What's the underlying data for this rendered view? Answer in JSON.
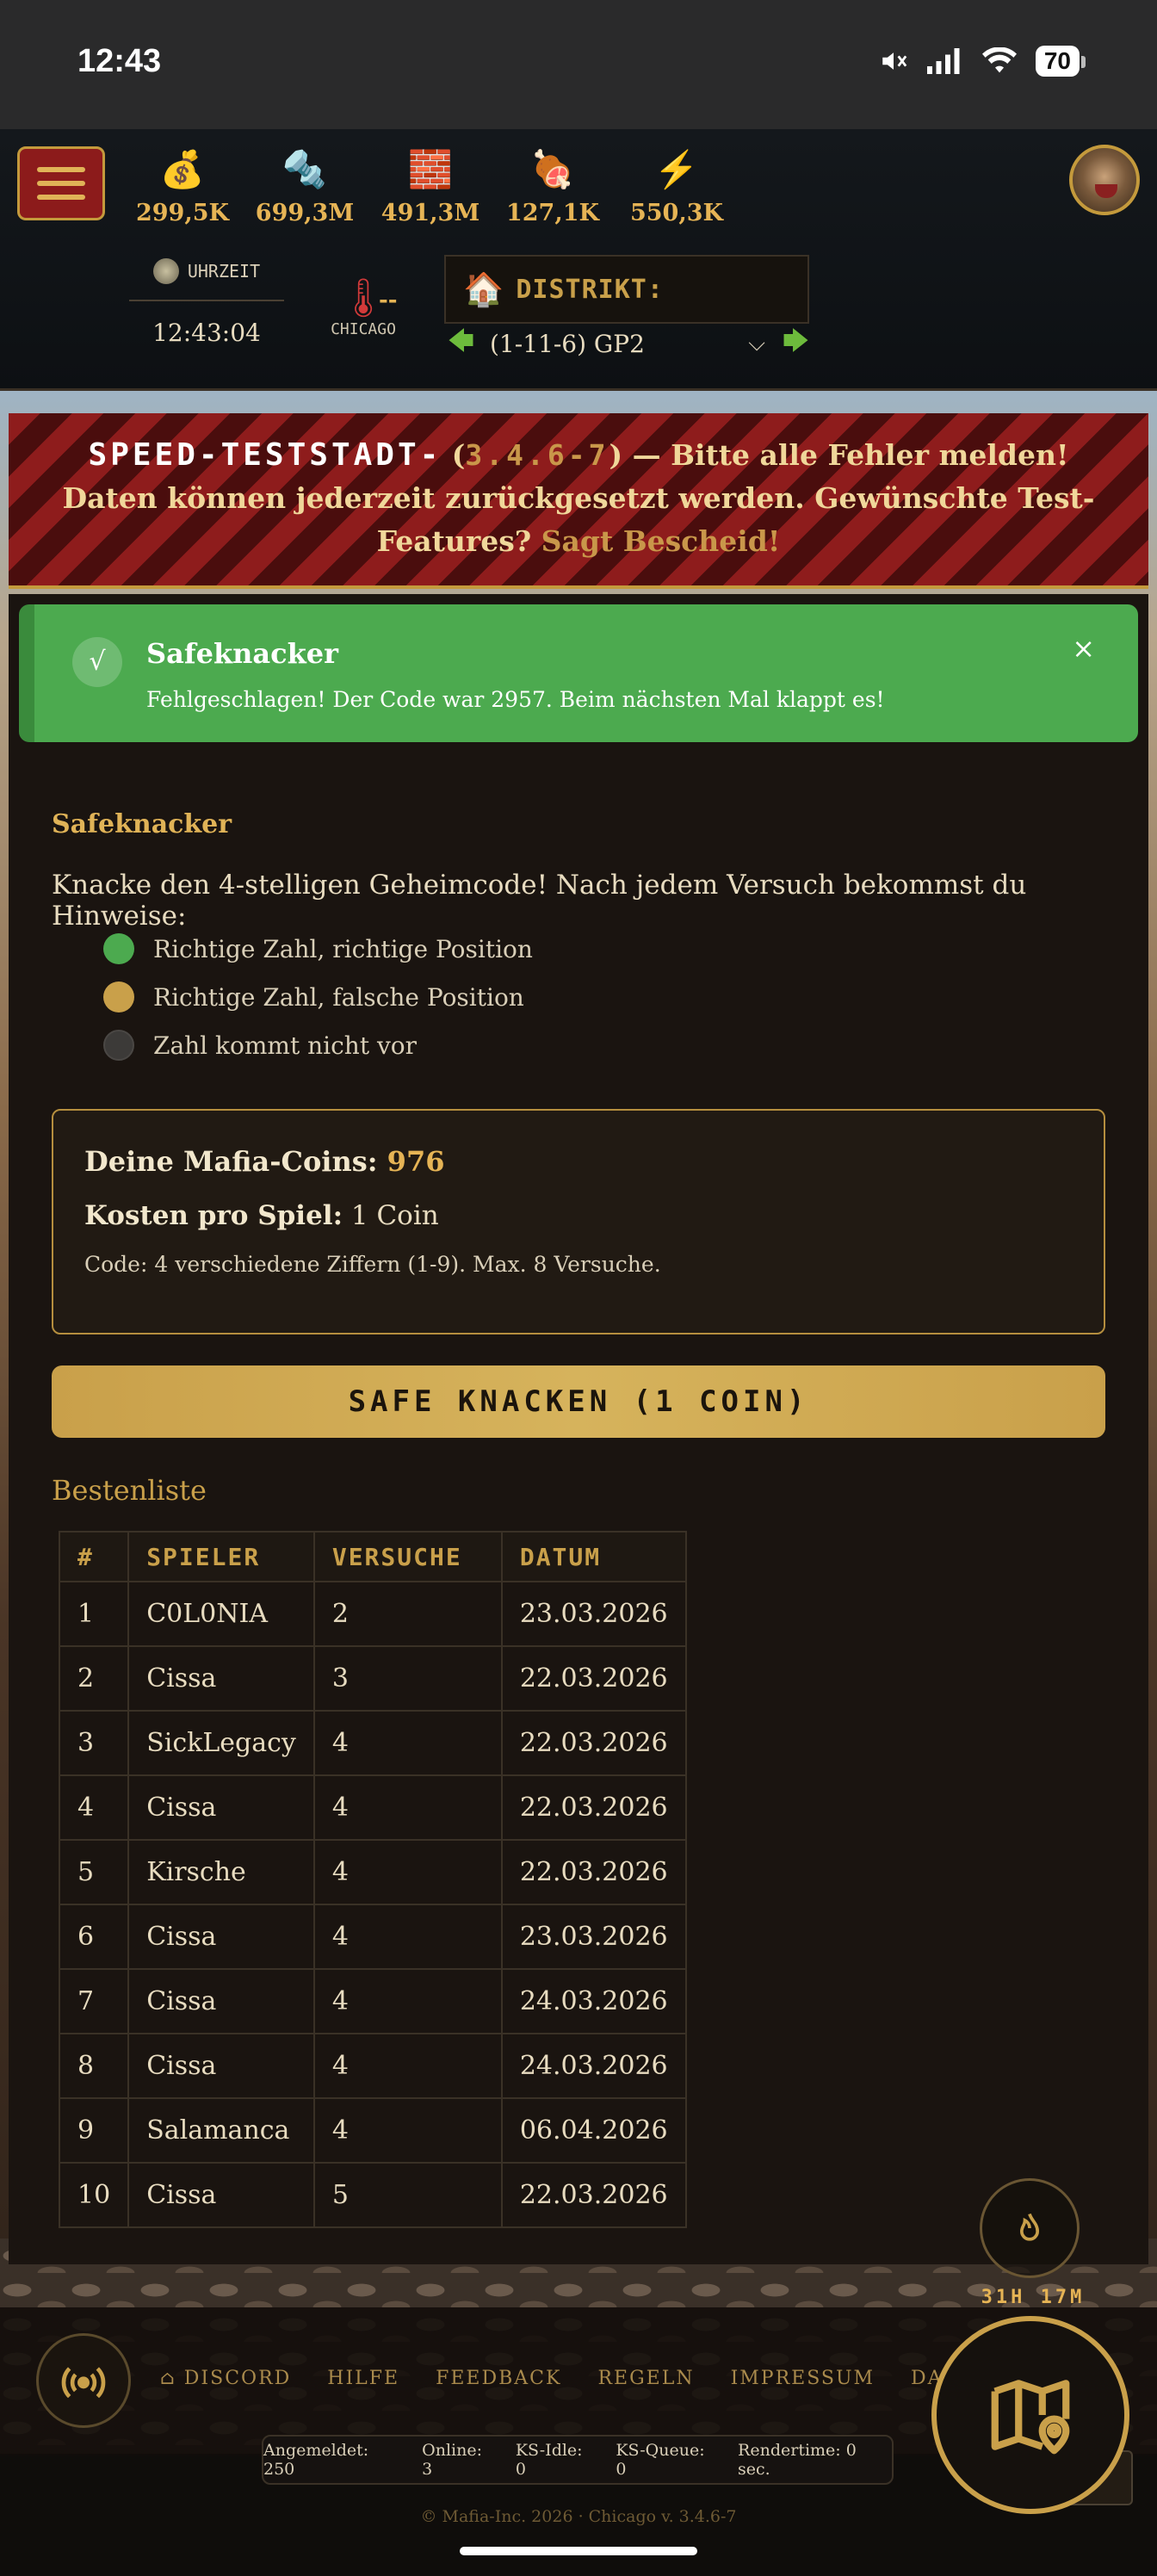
{
  "status_bar": {
    "time": "12:43",
    "battery": "70"
  },
  "header": {
    "resources": [
      {
        "icon": "money-bag-icon",
        "glyph": "💰",
        "value": "299,5K"
      },
      {
        "icon": "bolt-nut-icon",
        "glyph": "🔩",
        "value": "699,3M"
      },
      {
        "icon": "brick-icon",
        "glyph": "🧱",
        "value": "491,3M"
      },
      {
        "icon": "meat-icon",
        "glyph": "🍖",
        "value": "127,1K"
      },
      {
        "icon": "lightning-icon",
        "glyph": "⚡",
        "value": "550,3K"
      }
    ],
    "clock_label": "UHRZEIT",
    "clock_time": "12:43:04",
    "temperature": "--",
    "city": "CHICAGO",
    "district_label": "DISTRIKT:",
    "district_value": "(1-11-6) GP2"
  },
  "banner": {
    "name": "SPEED-TESTSTADT-",
    "open": " (",
    "version": "3.4.6-7",
    "close": ")",
    "text": " — Bitte alle Fehler melden! Daten können jederzeit zurückgesetzt werden. Gewünschte Test-Features? ",
    "link": "Sagt Bescheid!"
  },
  "toast": {
    "check": "√",
    "title": "Safeknacker",
    "message": "Fehlgeschlagen! Der Code war 2957. Beim nächsten Mal klappt es!",
    "close": "×"
  },
  "game": {
    "title": "Safeknacker",
    "intro": "Knacke den 4-stelligen Geheimcode! Nach jedem Versuch bekommst du Hinweise:",
    "legend": [
      {
        "color": "green",
        "label": "Richtige Zahl, richtige Position"
      },
      {
        "color": "gold",
        "label": "Richtige Zahl, falsche Position"
      },
      {
        "color": "grey",
        "label": "Zahl kommt nicht vor"
      }
    ],
    "coins_label": "Deine Mafia-Coins:",
    "coins_value": "976",
    "cost_label": "Kosten pro Spiel:",
    "cost_value": "1 Coin",
    "rules": "Code: 4 verschiedene Ziffern (1-9). Max. 8 Versuche.",
    "button": "SAFE KNACKEN (1 COIN)"
  },
  "leaderboard": {
    "title": "Bestenliste",
    "headers": [
      "#",
      "SPIELER",
      "VERSUCHE",
      "DATUM"
    ],
    "rows": [
      [
        "1",
        "C0L0NIA",
        "2",
        "23.03.2026"
      ],
      [
        "2",
        "Cissa",
        "3",
        "22.03.2026"
      ],
      [
        "3",
        "SickLegacy",
        "4",
        "22.03.2026"
      ],
      [
        "4",
        "Cissa",
        "4",
        "22.03.2026"
      ],
      [
        "5",
        "Kirsche",
        "4",
        "22.03.2026"
      ],
      [
        "6",
        "Cissa",
        "4",
        "23.03.2026"
      ],
      [
        "7",
        "Cissa",
        "4",
        "24.03.2026"
      ],
      [
        "8",
        "Cissa",
        "4",
        "24.03.2026"
      ],
      [
        "9",
        "Salamanca",
        "4",
        "06.04.2026"
      ],
      [
        "10",
        "Cissa",
        "5",
        "22.03.2026"
      ]
    ]
  },
  "floating": {
    "timer": "31H 17M"
  },
  "footer": {
    "nav": [
      "DISCORD",
      "HILFE",
      "FEEDBACK",
      "REGELN",
      "IMPRESSUM",
      "DATENSC"
    ],
    "stats": [
      "Angemeldet: 250",
      "Online: 3",
      "KS-Idle: 0",
      "KS-Queue: 0",
      "Rendertime: 0 sec."
    ],
    "hilfe": "Hilfe",
    "copyright": "© Mafia-Inc. 2026 · Chicago v. 3.4.6-7"
  },
  "colors": {
    "accent": "#c9a04a",
    "success": "#4caa4f",
    "banner_red": "#8e1c1c"
  }
}
